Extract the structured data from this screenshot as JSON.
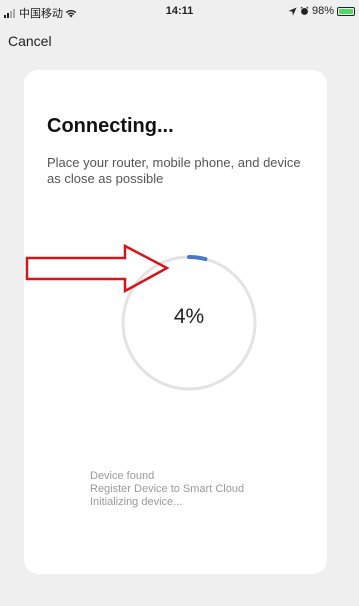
{
  "status_bar": {
    "carrier": "中国移动",
    "time": "14:11",
    "battery_text": "98%",
    "wifi_icon": "wifi-icon",
    "location_icon": "location-arrow-icon",
    "alarm_icon": "alarm-icon",
    "battery_level": 0.98
  },
  "nav": {
    "cancel_label": "Cancel"
  },
  "connect": {
    "title": "Connecting...",
    "subtitle": "Place your router, mobile phone, and device as close as possible",
    "progress_text": "4%",
    "progress_value": 0.04
  },
  "steps": [
    {
      "label": "Device found"
    },
    {
      "label": "Register Device to Smart Cloud"
    },
    {
      "label": "Initializing device..."
    }
  ],
  "colors": {
    "background": "#efefef",
    "card": "#ffffff",
    "ring_track": "#e3e3e3",
    "ring_progress": "#4a78c9",
    "arrow": "#d8141a",
    "step_text": "#9a9a9a"
  }
}
